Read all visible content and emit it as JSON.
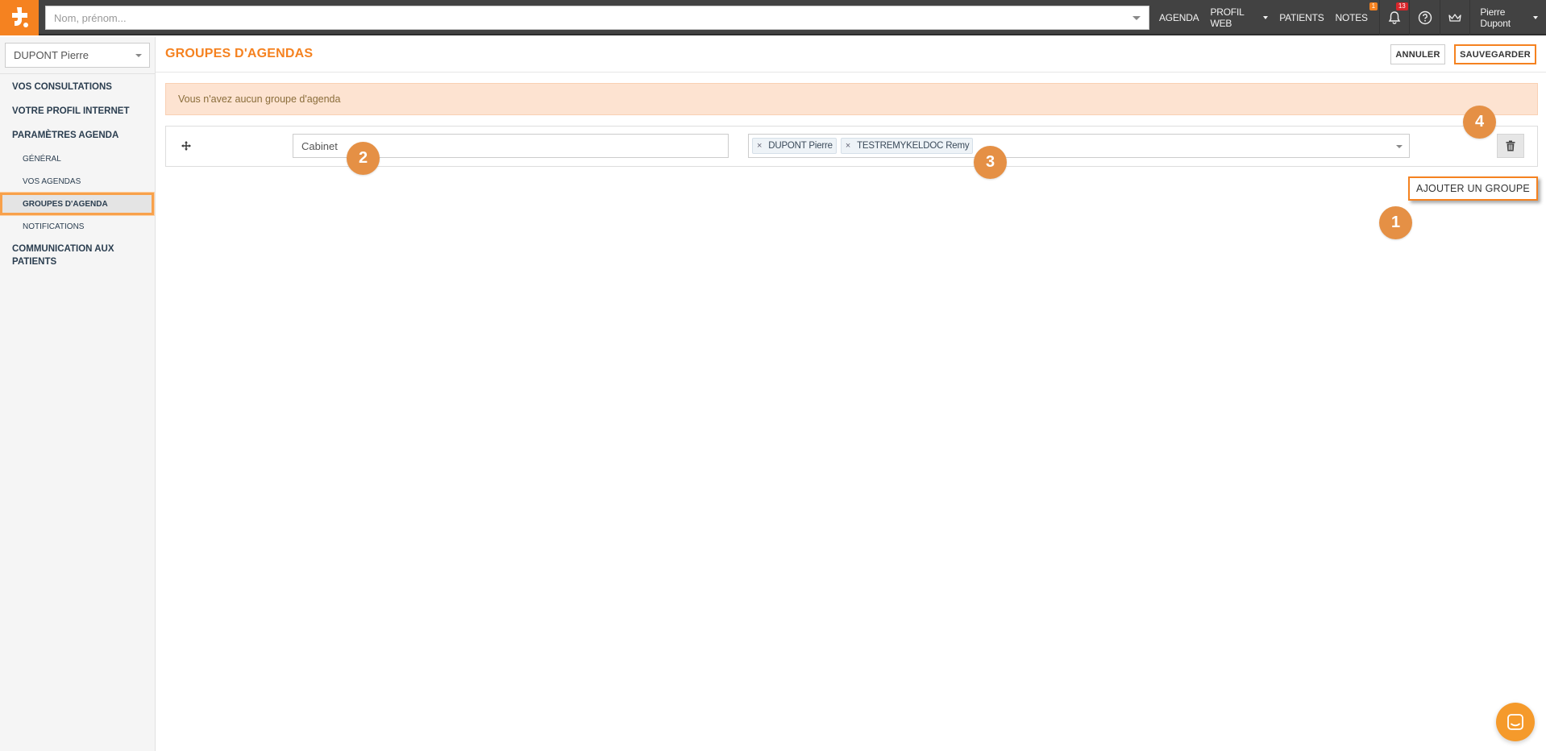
{
  "topbar": {
    "search_placeholder": "Nom, prénom...",
    "nav": {
      "agenda": "AGENDA",
      "profil_web": "PROFIL WEB",
      "patients": "PATIENTS",
      "notes": "NOTES",
      "notes_badge": "1"
    },
    "notifications_badge": "13",
    "user_name": "Pierre Dupont",
    "icons": [
      "logo-icon",
      "bell-icon",
      "help-icon",
      "crown-icon"
    ],
    "accent_color": "#f58220"
  },
  "sidebar": {
    "doctor_select": "DUPONT Pierre",
    "menu": {
      "consultations": "VOS CONSULTATIONS",
      "profil_internet": "VOTRE PROFIL INTERNET",
      "parametres_agenda": "PARAMÈTRES AGENDA",
      "general": "GÉNÉRAL",
      "vos_agendas": "VOS AGENDAS",
      "groupes_agenda": "GROUPES D'AGENDA",
      "notifications": "NOTIFICATIONS",
      "communication": "COMMUNICATION AUX PATIENTS"
    }
  },
  "main": {
    "title": "GROUPES D'AGENDAS",
    "cancel_label": "ANNULER",
    "save_label": "SAUVEGARDER",
    "alert_text": "Vous n'avez aucun groupe d'agenda",
    "group": {
      "name_value": "Cabinet",
      "tags": [
        "DUPONT Pierre",
        "TESTREMYKELDOC Remy"
      ],
      "tag_remove_symbol": "×"
    },
    "add_group_label": "AJOUTER UN GROUPE"
  },
  "steps": [
    "1",
    "2",
    "3",
    "4"
  ]
}
